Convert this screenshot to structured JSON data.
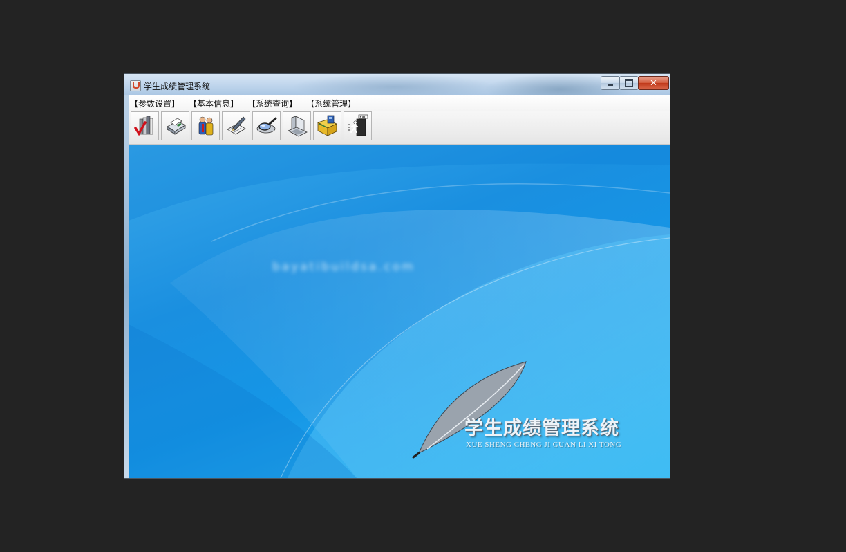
{
  "window": {
    "title": "学生成绩管理系统",
    "controls": {
      "minimize_icon": "minimize-icon",
      "maximize_icon": "maximize-icon",
      "close_icon": "close-icon",
      "close_glyph": "✕"
    }
  },
  "menubar": {
    "items": [
      {
        "label": "【参数设置】"
      },
      {
        "label": "【基本信息】"
      },
      {
        "label": "【系统查询】"
      },
      {
        "label": "【系统管理】"
      }
    ]
  },
  "toolbar": {
    "buttons": [
      {
        "icon": "checklist-books-icon"
      },
      {
        "icon": "fax-machine-icon"
      },
      {
        "icon": "users-icon"
      },
      {
        "icon": "edit-document-icon"
      },
      {
        "icon": "magnifier-search-icon"
      },
      {
        "icon": "computer-icon"
      },
      {
        "icon": "folder-network-icon"
      },
      {
        "icon": "exit-door-icon"
      }
    ]
  },
  "content": {
    "blurred_text": "bayatibuildsa.com",
    "logo": {
      "title": "学生成绩管理系统",
      "pinyin": "XUE SHENG CHENG JI GUAN LI XI TONG",
      "icon": "quill-feather-icon"
    },
    "colors": {
      "background_primary": "#1a8fe0",
      "background_light": "#2cb6f2",
      "close_button": "#c0391a"
    }
  }
}
